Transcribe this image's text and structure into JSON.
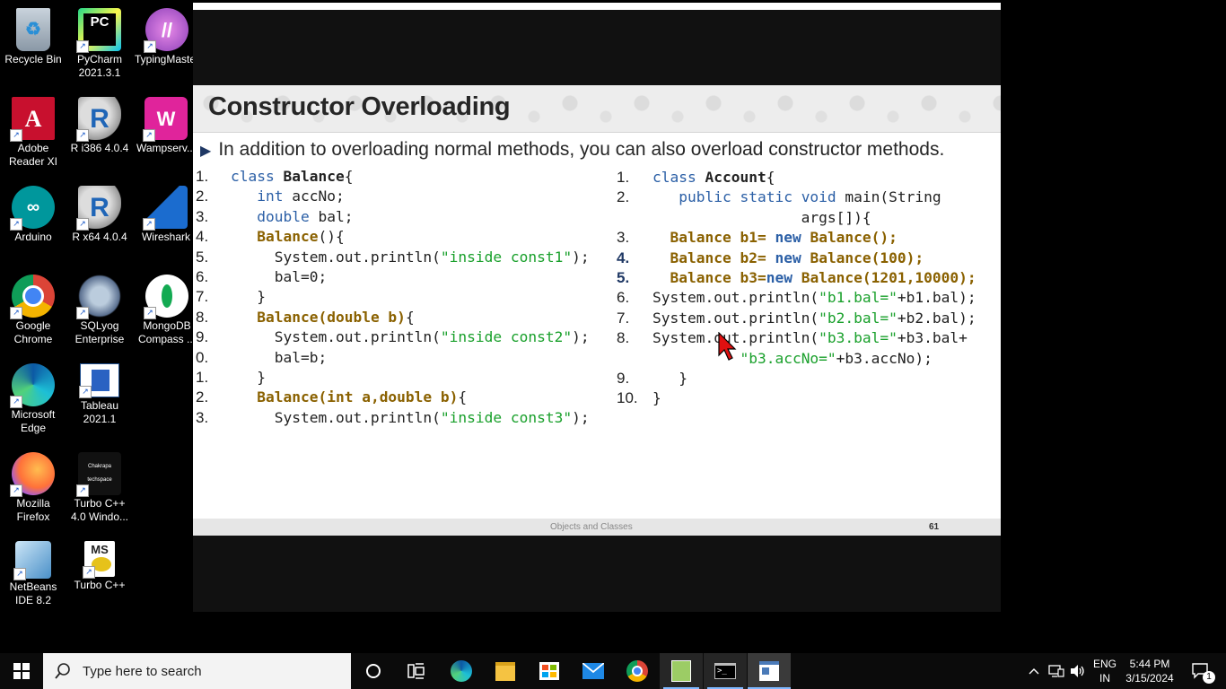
{
  "desktop": {
    "icons": [
      {
        "label": "Recycle Bin"
      },
      {
        "label": "PyCharm 2021.3.1"
      },
      {
        "label": "TypingMaster Pro"
      },
      {
        "label": "Adobe Reader XI"
      },
      {
        "label": "R i386 4.0.4"
      },
      {
        "label": "Wampserv..."
      },
      {
        "label": "Arduino"
      },
      {
        "label": "R x64 4.0.4"
      },
      {
        "label": "Wireshark"
      },
      {
        "label": "Google Chrome"
      },
      {
        "label": "SQLyog Enterprise"
      },
      {
        "label": "MongoDB Compass ..."
      },
      {
        "label": "Microsoft Edge"
      },
      {
        "label": "Tableau 2021.1"
      },
      {
        "label": "Mozilla Firefox"
      },
      {
        "label": "Turbo C++ 4.0 Windo..."
      },
      {
        "label": "NetBeans IDE 8.2"
      },
      {
        "label": "Turbo C++"
      }
    ]
  },
  "slide": {
    "title": "Constructor Overloading",
    "bullet": "In addition to overloading normal methods, you can also overload constructor methods.",
    "footer_text": "Objects and Classes",
    "page_number": "61",
    "left_numbers": [
      "1.",
      "2.",
      "3.",
      "4.",
      "5.",
      "6.",
      "7.",
      "8.",
      "9.",
      "0.",
      "1.",
      "2.",
      "3."
    ],
    "right_numbers": [
      "1.",
      "2.",
      "",
      "3.",
      "4.",
      "5.",
      "6.",
      "7.",
      "8.",
      "",
      "9.",
      "10."
    ]
  },
  "taskbar": {
    "search_placeholder": "Type here to search",
    "language_top": "ENG",
    "language_bottom": "IN",
    "time": "5:44 PM",
    "date": "3/15/2024",
    "notification_count": "1"
  },
  "colors": {
    "keyword": "#2b5fa6",
    "class_ref": "#8a6100",
    "string": "#19a02b",
    "accent": "#1f3864"
  }
}
